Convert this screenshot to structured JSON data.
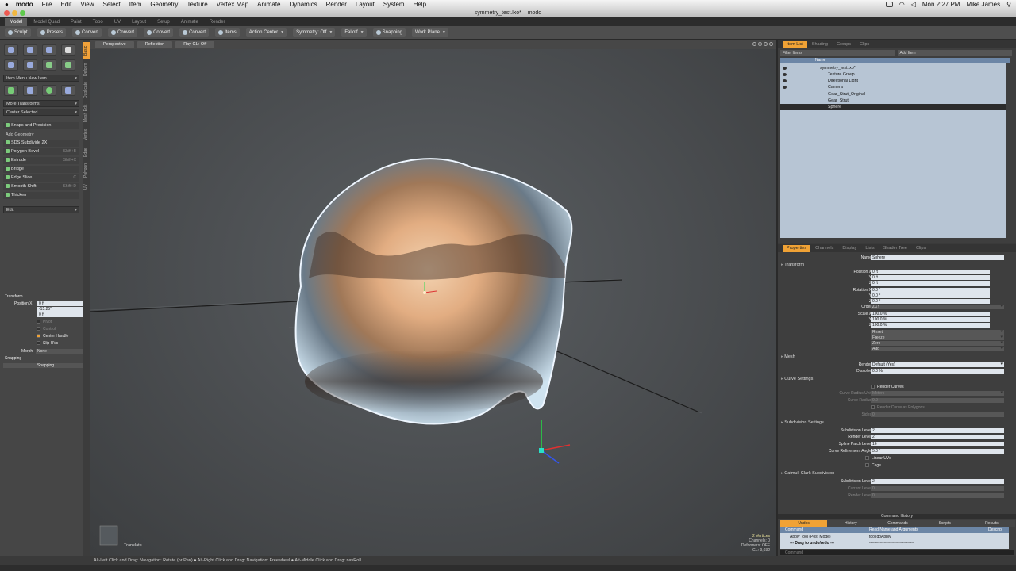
{
  "menubar": {
    "app": "modo",
    "items": [
      "File",
      "Edit",
      "View",
      "Select",
      "Item",
      "Geometry",
      "Texture",
      "Vertex Map",
      "Animate",
      "Dynamics",
      "Render",
      "Layout",
      "System",
      "Help"
    ],
    "clock": "Mon 2:27 PM",
    "user": "Mike James"
  },
  "window": {
    "title": "symmetry_test.lxo* – modo"
  },
  "layout_tabs": [
    "Model",
    "Model Quad",
    "Paint",
    "Topo",
    "UV",
    "Layout",
    "Setup",
    "Animate",
    "Render"
  ],
  "toolbar": {
    "items": [
      {
        "label": "Sculpt",
        "dd": false
      },
      {
        "label": "Presets",
        "dd": false
      },
      {
        "label": "Convert",
        "dd": false
      },
      {
        "label": "Convert",
        "dd": false
      },
      {
        "label": "Convert",
        "dd": false
      },
      {
        "label": "Convert",
        "dd": false
      },
      {
        "label": "Items",
        "dd": false
      },
      {
        "label": "Action Center",
        "dd": true
      },
      {
        "label": "Symmetry: Off",
        "dd": true
      },
      {
        "label": "Falloff",
        "dd": true
      },
      {
        "label": "Snapping",
        "dd": false
      },
      {
        "label": "Work Plane",
        "dd": true
      }
    ]
  },
  "left": {
    "vtabs": [
      "Basic",
      "Deform",
      "Duplicate",
      "Mesh Edit",
      "Vertex",
      "Edge",
      "Polygon",
      "UV"
    ],
    "item_menu": "Item Menu",
    "new_item": "New Item",
    "more_transforms": "More Transforms",
    "center_selected": "Center Selected",
    "snaps": "Snaps and Precision",
    "add_geometry": "Add Geometry",
    "tools": [
      {
        "label": "SDS Subdivide 2X",
        "key": ""
      },
      {
        "label": "Polygon Bevel",
        "key": "Shift+B"
      },
      {
        "label": "Extrude",
        "key": "Shift+X"
      },
      {
        "label": "Bridge",
        "key": ""
      },
      {
        "label": "Edge Slice",
        "key": "C"
      },
      {
        "label": "Smooth Shift",
        "key": "Shift+D"
      },
      {
        "label": "Thicken",
        "key": ""
      }
    ],
    "edit": "Edit",
    "transform_header": "Transform",
    "position_label": "Position X",
    "pos": [
      "0 ft",
      "-15.25\"",
      "0 ft"
    ],
    "options": [
      {
        "label": "Pivot",
        "checked": false,
        "dim": true
      },
      {
        "label": "Control",
        "checked": false,
        "dim": true
      },
      {
        "label": "Center Handle",
        "checked": true,
        "dim": false
      },
      {
        "label": "Slip UVs",
        "checked": false,
        "dim": false
      }
    ],
    "morph_label": "Morph",
    "morph_value": "None",
    "snapping_header": "Snapping",
    "snapping_button": "Snapping"
  },
  "viewport": {
    "buttons": [
      "Perspective",
      "Reflection",
      "Ray GL: Off"
    ],
    "stats": [
      "2 Vertices",
      "Channels: 0",
      "Deformers: OFF",
      "GL: 9,032"
    ],
    "translate": "Translate"
  },
  "statusbar": "Alt-Left Click and Drag: Navigation: Rotate (or Pan) ● Alt-Right Click and Drag: Navigation: Freewheel ● Alt-Middle Click and Drag: navRoll",
  "itemlist": {
    "tabs": [
      "Item List",
      "Shading",
      "Groups",
      "Clips"
    ],
    "filter": "Filter Items",
    "add_item": "Add Item",
    "header": "Name",
    "rows": [
      {
        "name": "symmetry_test.lxo*",
        "indent": 0,
        "eye": true,
        "selected": false
      },
      {
        "name": "Texture Group",
        "indent": 1,
        "eye": true,
        "selected": false
      },
      {
        "name": "Directional Light",
        "indent": 1,
        "eye": true,
        "selected": false
      },
      {
        "name": "Camera",
        "indent": 1,
        "eye": true,
        "selected": false
      },
      {
        "name": "Gear_Strut_Original",
        "indent": 1,
        "eye": false,
        "selected": false
      },
      {
        "name": "Gear_Strut",
        "indent": 1,
        "eye": false,
        "selected": false
      },
      {
        "name": "Sphere",
        "indent": 1,
        "eye": false,
        "selected": true
      }
    ]
  },
  "properties": {
    "tabs": [
      "Properties",
      "Channels",
      "Display",
      "Lists",
      "Shader Tree",
      "Clips"
    ],
    "name_label": "Name",
    "name_value": "Sphere",
    "transform": "Transform",
    "position_x_label": "Position X",
    "position": [
      "0 ft",
      "0 ft",
      "0 ft"
    ],
    "rotation_x_label": "Rotation X",
    "rotation": [
      "0.0 °",
      "0.0 °",
      "0.0 °"
    ],
    "order_label": "Order",
    "order_value": "ZXY",
    "scale_x_label": "Scale X",
    "scale": [
      "100.0 %",
      "100.0 %",
      "100.0 %"
    ],
    "actions": [
      "Reset",
      "Freeze",
      "Zero",
      "Add"
    ],
    "y_label": "Y",
    "z_label": "Z",
    "mesh": "Mesh",
    "render_label": "Render",
    "render_value": "Default (Yes)",
    "dissolve_label": "Dissolve",
    "dissolve_value": "0.0 %",
    "curve_settings": "Curve Settings",
    "render_curves": "Render Curves",
    "curve_radius_unit": "Curve Radius Unit",
    "curve_radius_unit_value": "Meters",
    "curve_radius": "Curve Radius",
    "curve_radius_value": "0.0",
    "render_curve_poly": "Render Curve as Polygons",
    "sides": "Sides",
    "sides_value": "0",
    "subdivision_settings": "Subdivision Settings",
    "sub_level_label": "Subdivision Level",
    "sub_level": "2",
    "render_level_label": "Render Level",
    "render_level": "2",
    "spline_patch_label": "Spline Patch Level",
    "spline_patch": "16",
    "curve_refine_label": "Curve Refinement Angle",
    "curve_refine": "5.0 °",
    "linear_uvs": "Linear UVs",
    "cage": "Cage",
    "catmull": "Catmull-Clark Subdivision",
    "cc_sub_level": "2",
    "current_level": "Current Level",
    "current_level_value": "0",
    "cc_render_level": "Render Level",
    "cc_render_level_value": "0"
  },
  "commands": {
    "title": "Command History",
    "tabs": [
      "Undos",
      "History",
      "Commands",
      "Scripts",
      "Results"
    ],
    "head": [
      "Command",
      "Read Name and Arguments",
      "Descrip"
    ],
    "rows": [
      {
        "cmd": "Apply Tool (Post Mode)",
        "arg": "tool.doApply"
      },
      {
        "cmd": "--- Drag to undo/redo ---",
        "arg": "----------------------------------"
      }
    ],
    "input": "Command"
  },
  "colors": {
    "accent": "#f0a235",
    "selection": "#6c86a6"
  }
}
